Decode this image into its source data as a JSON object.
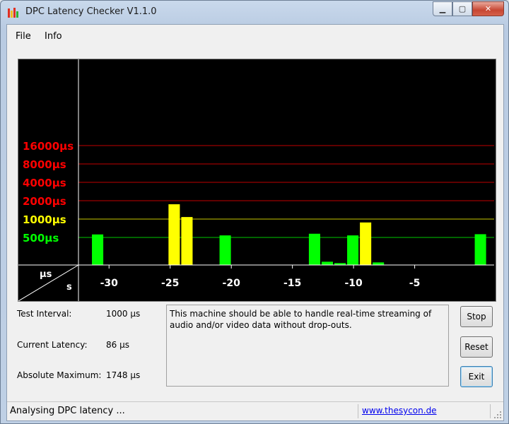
{
  "window": {
    "title": "DPC Latency Checker V1.1.0"
  },
  "menu": {
    "items": [
      "File",
      "Info"
    ]
  },
  "chart_data": {
    "type": "bar",
    "y_scale": "log",
    "y_ticks": [
      {
        "label": "16000µs",
        "value": 16000,
        "color": "#ff0000"
      },
      {
        "label": "8000µs",
        "value": 8000,
        "color": "#ff0000"
      },
      {
        "label": "4000µs",
        "value": 4000,
        "color": "#ff0000"
      },
      {
        "label": "2000µs",
        "value": 2000,
        "color": "#ff0000"
      },
      {
        "label": "1000µs",
        "value": 1000,
        "color": "#ffff00"
      },
      {
        "label": "500µs",
        "value": 500,
        "color": "#00ff00"
      }
    ],
    "x_ticks": [
      "-30",
      "-25",
      "-20",
      "-15",
      "-10",
      "-5"
    ],
    "x_tick_values": [
      -30,
      -25,
      -20,
      -15,
      -10,
      -5
    ],
    "x_range": [
      -32.5,
      1.5
    ],
    "y_axis_unit": "µs",
    "x_axis_unit": "s",
    "series": [
      {
        "x": -33,
        "value": 80,
        "color": "#00ff00"
      },
      {
        "x": -32,
        "value": 560,
        "color": "#00ff00"
      },
      {
        "x": -31,
        "value": 150,
        "color": "#00ff00"
      },
      {
        "x": -30,
        "value": 87,
        "color": "#00ff00"
      },
      {
        "x": -29,
        "value": 92,
        "color": "#00ff00"
      },
      {
        "x": -28,
        "value": 78,
        "color": "#00ff00"
      },
      {
        "x": -27,
        "value": 70,
        "color": "#00ff00"
      },
      {
        "x": -26,
        "value": 1748,
        "color": "#ffff00"
      },
      {
        "x": -25,
        "value": 1080,
        "color": "#ffff00"
      },
      {
        "x": -24,
        "value": 78,
        "color": "#00ff00"
      },
      {
        "x": -23,
        "value": 68,
        "color": "#00ff00"
      },
      {
        "x": -22,
        "value": 540,
        "color": "#00ff00"
      },
      {
        "x": -21,
        "value": 80,
        "color": "#00ff00"
      },
      {
        "x": -20,
        "value": 80,
        "color": "#00ff00"
      },
      {
        "x": -19,
        "value": 72,
        "color": "#00ff00"
      },
      {
        "x": -18,
        "value": 72,
        "color": "#00ff00"
      },
      {
        "x": -17,
        "value": 65,
        "color": "#00ff00"
      },
      {
        "x": -16,
        "value": 82,
        "color": "#00ff00"
      },
      {
        "x": -15,
        "value": 575,
        "color": "#00ff00"
      },
      {
        "x": -14,
        "value": 200,
        "color": "#00ff00"
      },
      {
        "x": -13,
        "value": 190,
        "color": "#00ff00"
      },
      {
        "x": -12,
        "value": 540,
        "color": "#00ff00"
      },
      {
        "x": -11,
        "value": 880,
        "color": "#ffff00"
      },
      {
        "x": -10,
        "value": 195,
        "color": "#00ff00"
      },
      {
        "x": -9,
        "value": 95,
        "color": "#00ff00"
      },
      {
        "x": -8,
        "value": 140,
        "color": "#00ff00"
      },
      {
        "x": -7,
        "value": 125,
        "color": "#00ff00"
      },
      {
        "x": -6,
        "value": 80,
        "color": "#00ff00"
      },
      {
        "x": -5,
        "value": 76,
        "color": "#00ff00"
      },
      {
        "x": -4,
        "value": 88,
        "color": "#00ff00"
      },
      {
        "x": -3,
        "value": 88,
        "color": "#00ff00"
      },
      {
        "x": -2,
        "value": 565,
        "color": "#00ff00"
      },
      {
        "x": -1,
        "value": 70,
        "color": "#00ff00"
      }
    ]
  },
  "info": {
    "test_interval_label": "Test Interval:",
    "test_interval_value": "1000 µs",
    "current_latency_label": "Current Latency:",
    "current_latency_value": "86 µs",
    "absolute_max_label": "Absolute Maximum:",
    "absolute_max_value": "1748 µs"
  },
  "message": "This machine should be able to handle real-time streaming of audio and/or video data without drop-outs.",
  "buttons": {
    "stop": "Stop",
    "reset": "Reset",
    "exit": "Exit"
  },
  "status": {
    "text": "Analysing DPC latency ...",
    "link": "www.thesycon.de"
  },
  "colors": {
    "chart_bg": "#000000",
    "grid_red": "#c00000",
    "grid_yellow": "#c8c800",
    "grid_green": "#00c800",
    "axis": "#ffffff"
  }
}
